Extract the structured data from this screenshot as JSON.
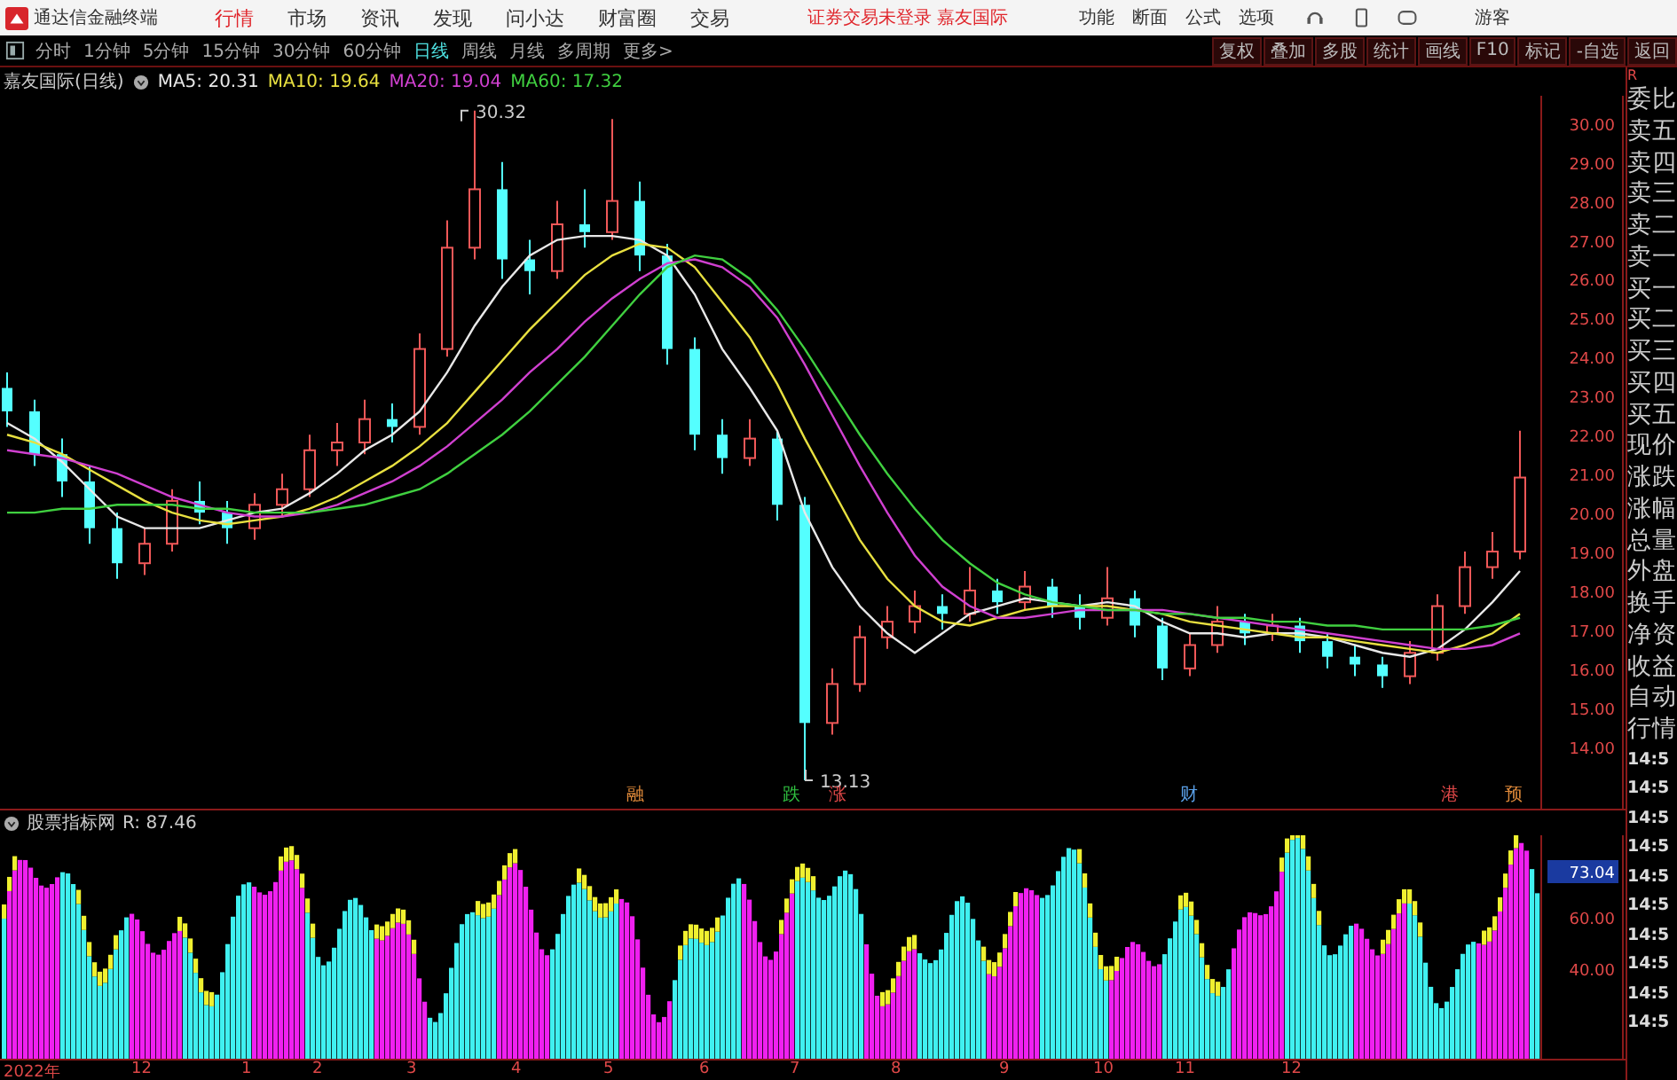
{
  "title_bar": {
    "app_name": "通达信金融终端",
    "menu": [
      {
        "label": "行情",
        "selected": true
      },
      {
        "label": "市场",
        "selected": false
      },
      {
        "label": "资讯",
        "selected": false
      },
      {
        "label": "发现",
        "selected": false
      },
      {
        "label": "问小达",
        "selected": false
      },
      {
        "label": "财富圈",
        "selected": false
      },
      {
        "label": "交易",
        "selected": false
      }
    ],
    "login_notice": "证券交易未登录 嘉友国际",
    "right_menu": [
      "功能",
      "断面",
      "公式",
      "选项"
    ],
    "user": "游客"
  },
  "toolbar": {
    "periods": [
      {
        "label": "分时",
        "selected": false
      },
      {
        "label": "1分钟",
        "selected": false
      },
      {
        "label": "5分钟",
        "selected": false
      },
      {
        "label": "15分钟",
        "selected": false
      },
      {
        "label": "30分钟",
        "selected": false
      },
      {
        "label": "60分钟",
        "selected": false
      },
      {
        "label": "日线",
        "selected": true
      },
      {
        "label": "周线",
        "selected": false
      },
      {
        "label": "月线",
        "selected": false
      },
      {
        "label": "多周期",
        "selected": false
      },
      {
        "label": "更多>",
        "selected": false
      }
    ],
    "actions": [
      "复权",
      "叠加",
      "多股",
      "统计",
      "画线",
      "F10",
      "标记",
      "-自选",
      "返回"
    ]
  },
  "price_chart": {
    "title": "嘉友国际(日线)",
    "ma_readings": [
      ": 20.31",
      ": 19.64",
      ": 19.04",
      ": 17.32"
    ],
    "high_label": "30.32",
    "low_label": "13.13",
    "event_tags": [
      {
        "label": "融",
        "color": "#e08a3a"
      },
      {
        "label": "跌",
        "color": "#30c040"
      },
      {
        "label": "涨",
        "color": "#e04848"
      },
      {
        "label": "财",
        "color": "#5aa0e8"
      },
      {
        "label": "港",
        "color": "#e04848"
      },
      {
        "label": "预",
        "color": "#e08a3a"
      }
    ],
    "chart_data": {
      "type": "candlestick",
      "ylim": [
        12.4,
        30.7
      ],
      "yticks": [
        {
          "value": 30,
          "label": "30.00"
        },
        {
          "value": 29,
          "label": "29.00"
        },
        {
          "value": 28,
          "label": "28.00"
        },
        {
          "value": 27,
          "label": "27.00"
        },
        {
          "value": 26,
          "label": "26.00"
        },
        {
          "value": 25,
          "label": "25.00"
        },
        {
          "value": 24,
          "label": "24.00"
        },
        {
          "value": 23,
          "label": "23.00"
        },
        {
          "value": 22,
          "label": "22.00"
        },
        {
          "value": 21,
          "label": "21.00"
        },
        {
          "value": 20,
          "label": "20.00"
        },
        {
          "value": 19,
          "label": "19.00"
        },
        {
          "value": 18,
          "label": "18.00"
        },
        {
          "value": 17,
          "label": "17.00"
        },
        {
          "value": 16,
          "label": "16.00"
        },
        {
          "value": 15,
          "label": "15.00"
        },
        {
          "value": 14,
          "label": "14.00"
        }
      ],
      "ohlc": [
        [
          23.2,
          23.6,
          22.2,
          22.6
        ],
        [
          22.6,
          22.9,
          21.2,
          21.5
        ],
        [
          21.5,
          21.9,
          20.4,
          20.8
        ],
        [
          20.8,
          21.2,
          19.2,
          19.6
        ],
        [
          19.6,
          20.0,
          18.3,
          18.7
        ],
        [
          18.7,
          19.6,
          18.4,
          19.2
        ],
        [
          19.2,
          20.6,
          19.0,
          20.3
        ],
        [
          20.3,
          20.8,
          19.7,
          20.0
        ],
        [
          20.0,
          20.3,
          19.2,
          19.6
        ],
        [
          19.6,
          20.5,
          19.3,
          20.2
        ],
        [
          20.2,
          21.0,
          19.9,
          20.6
        ],
        [
          20.6,
          22.0,
          20.4,
          21.6
        ],
        [
          21.6,
          22.3,
          21.2,
          21.8
        ],
        [
          21.8,
          22.9,
          21.5,
          22.4
        ],
        [
          22.4,
          22.8,
          21.8,
          22.2
        ],
        [
          22.2,
          24.6,
          22.0,
          24.2
        ],
        [
          24.2,
          27.5,
          24.0,
          26.8
        ],
        [
          26.8,
          30.32,
          26.5,
          28.3
        ],
        [
          28.3,
          29.0,
          26.0,
          26.5
        ],
        [
          26.5,
          27.0,
          25.6,
          26.2
        ],
        [
          26.2,
          28.0,
          26.0,
          27.4
        ],
        [
          27.4,
          28.3,
          26.8,
          27.2
        ],
        [
          27.2,
          30.1,
          27.0,
          28.0
        ],
        [
          28.0,
          28.5,
          26.2,
          26.6
        ],
        [
          26.6,
          26.9,
          23.8,
          24.2
        ],
        [
          24.2,
          24.5,
          21.6,
          22.0
        ],
        [
          22.0,
          22.4,
          21.0,
          21.4
        ],
        [
          21.4,
          22.4,
          21.2,
          21.9
        ],
        [
          21.9,
          22.1,
          19.8,
          20.2
        ],
        [
          20.2,
          20.4,
          13.13,
          14.6
        ],
        [
          14.6,
          16.0,
          14.3,
          15.6
        ],
        [
          15.6,
          17.1,
          15.4,
          16.8
        ],
        [
          16.8,
          17.6,
          16.5,
          17.2
        ],
        [
          17.2,
          18.0,
          16.9,
          17.6
        ],
        [
          17.6,
          17.9,
          17.0,
          17.4
        ],
        [
          17.4,
          18.6,
          17.2,
          18.0
        ],
        [
          18.0,
          18.3,
          17.4,
          17.7
        ],
        [
          17.7,
          18.5,
          17.5,
          18.1
        ],
        [
          18.1,
          18.3,
          17.3,
          17.6
        ],
        [
          17.6,
          17.9,
          17.0,
          17.3
        ],
        [
          17.3,
          18.6,
          17.1,
          17.8
        ],
        [
          17.8,
          18.0,
          16.8,
          17.1
        ],
        [
          17.1,
          17.3,
          15.7,
          16.0
        ],
        [
          16.0,
          16.9,
          15.8,
          16.6
        ],
        [
          16.6,
          17.6,
          16.4,
          17.2
        ],
        [
          17.2,
          17.4,
          16.6,
          16.9
        ],
        [
          16.9,
          17.4,
          16.7,
          17.1
        ],
        [
          17.1,
          17.3,
          16.4,
          16.7
        ],
        [
          16.7,
          16.9,
          16.0,
          16.3
        ],
        [
          16.3,
          16.6,
          15.8,
          16.1
        ],
        [
          16.1,
          16.3,
          15.5,
          15.8
        ],
        [
          15.8,
          16.7,
          15.6,
          16.4
        ],
        [
          16.4,
          17.9,
          16.2,
          17.6
        ],
        [
          17.6,
          19.0,
          17.4,
          18.6
        ],
        [
          18.6,
          19.5,
          18.3,
          19.0
        ],
        [
          19.0,
          22.1,
          18.8,
          20.9
        ]
      ],
      "series": [
        {
          "name": "MA5",
          "type": "line",
          "color": "#e8e8e8",
          "values": [
            22.3,
            21.9,
            21.3,
            20.6,
            19.9,
            19.6,
            19.6,
            19.6,
            19.8,
            20.0,
            20.1,
            20.5,
            21.0,
            21.6,
            22.0,
            22.6,
            23.6,
            24.8,
            25.8,
            26.6,
            27.0,
            27.1,
            27.1,
            27.0,
            26.6,
            25.6,
            24.2,
            23.2,
            22.1,
            20.0,
            18.6,
            17.6,
            16.9,
            16.4,
            16.9,
            17.4,
            17.6,
            17.8,
            17.7,
            17.6,
            17.7,
            17.6,
            17.2,
            16.9,
            16.9,
            16.8,
            16.9,
            16.9,
            16.8,
            16.6,
            16.4,
            16.3,
            16.5,
            17.0,
            17.7,
            18.5
          ]
        },
        {
          "name": "MA10",
          "type": "line",
          "color": "#e8e040",
          "values": [
            22.0,
            21.8,
            21.5,
            21.1,
            20.7,
            20.3,
            20.0,
            19.8,
            19.7,
            19.8,
            19.9,
            20.1,
            20.4,
            20.8,
            21.2,
            21.7,
            22.3,
            23.1,
            23.9,
            24.7,
            25.4,
            26.1,
            26.6,
            26.9,
            26.8,
            26.3,
            25.4,
            24.5,
            23.3,
            21.9,
            20.6,
            19.3,
            18.3,
            17.6,
            17.2,
            17.1,
            17.3,
            17.5,
            17.6,
            17.6,
            17.6,
            17.5,
            17.4,
            17.2,
            17.1,
            17.0,
            16.9,
            16.8,
            16.8,
            16.7,
            16.6,
            16.5,
            16.4,
            16.6,
            16.9,
            17.4
          ]
        },
        {
          "name": "MA20",
          "type": "line",
          "color": "#d040d0",
          "values": [
            21.6,
            21.5,
            21.4,
            21.2,
            21.0,
            20.7,
            20.4,
            20.2,
            20.0,
            19.9,
            19.9,
            20.0,
            20.2,
            20.5,
            20.8,
            21.2,
            21.7,
            22.3,
            22.9,
            23.6,
            24.2,
            24.9,
            25.5,
            26.0,
            26.4,
            26.5,
            26.3,
            25.8,
            25.0,
            23.8,
            22.5,
            21.2,
            20.0,
            18.9,
            18.1,
            17.6,
            17.3,
            17.3,
            17.4,
            17.5,
            17.5,
            17.5,
            17.5,
            17.4,
            17.3,
            17.2,
            17.1,
            17.0,
            16.9,
            16.8,
            16.7,
            16.6,
            16.5,
            16.5,
            16.6,
            16.9
          ]
        },
        {
          "name": "MA60",
          "type": "line",
          "color": "#40d040",
          "values": [
            20.0,
            20.0,
            20.1,
            20.1,
            20.2,
            20.2,
            20.2,
            20.1,
            20.1,
            20.0,
            20.0,
            20.0,
            20.1,
            20.2,
            20.4,
            20.6,
            21.0,
            21.5,
            22.0,
            22.6,
            23.3,
            24.0,
            24.8,
            25.6,
            26.3,
            26.6,
            26.5,
            26.0,
            25.2,
            24.2,
            23.1,
            22.0,
            21.0,
            20.1,
            19.3,
            18.7,
            18.2,
            17.9,
            17.7,
            17.6,
            17.5,
            17.5,
            17.4,
            17.4,
            17.3,
            17.3,
            17.2,
            17.2,
            17.1,
            17.1,
            17.0,
            17.0,
            17.0,
            17.0,
            17.1,
            17.3
          ]
        }
      ]
    }
  },
  "time_axis": {
    "labels": [
      "2022年",
      "12",
      "1",
      "2",
      "3",
      "4",
      "5",
      "6",
      "7",
      "8",
      "9",
      "10",
      "11",
      "12"
    ]
  },
  "indicator": {
    "name": "股票指标网",
    "reading": "R: 87.46",
    "current_value": "73.04",
    "ticks": [
      "60.00",
      "40.00"
    ]
  },
  "quote_panel": {
    "corner": "R",
    "labels": [
      "委比",
      "卖五",
      "卖四",
      "卖三",
      "卖二",
      "卖一",
      "买一",
      "买二",
      "买三",
      "买四",
      "买五",
      "现价",
      "涨跌",
      "涨幅",
      "总量",
      "外盘",
      "换手",
      "净资",
      "收益",
      "自动",
      "行情"
    ],
    "times": [
      "14:5",
      "14:5",
      "14:5",
      "14:5",
      "14:5",
      "14:5",
      "14:5",
      "14:5",
      "14:5",
      "14:5"
    ]
  }
}
